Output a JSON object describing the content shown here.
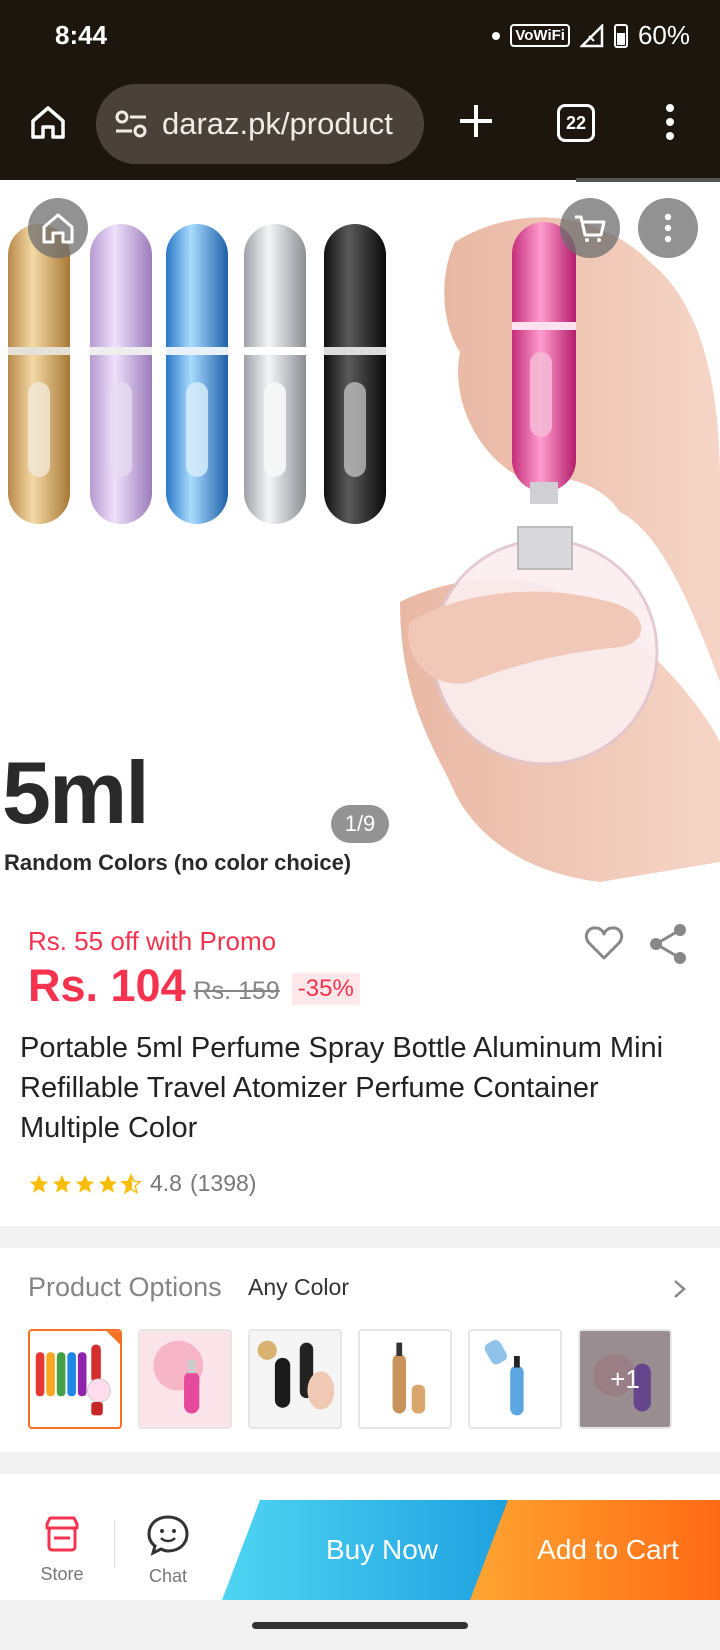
{
  "status_bar": {
    "time": "8:44",
    "network": "VoWiFi",
    "battery": "60%"
  },
  "browser": {
    "url": "daraz.pk/product",
    "tab_count": "22"
  },
  "hero": {
    "counter": "1/9",
    "text_size": "5ml",
    "text_colors": "Random Colors (no color choice)"
  },
  "product": {
    "promo": "Rs. 55 off with Promo",
    "price": "Rs. 104",
    "old_price": "Rs. 159",
    "discount": "-35%",
    "title": "Portable 5ml Perfume Spray Bottle Aluminum Mini Refillable Travel Atomizer Perfume Container Multiple Color",
    "rating": "4.8",
    "rating_count": "(1398)",
    "stars": 4.8
  },
  "options": {
    "label": "Product Options",
    "value": "Any Color",
    "more_count": "+1"
  },
  "bottom_bar": {
    "store": "Store",
    "chat": "Chat",
    "buy_now": "Buy Now",
    "add_to_cart": "Add to Cart"
  },
  "colors": {
    "price_red": "#f5334f",
    "accent_orange": "#f57224",
    "buy_now_blue": "#1ea0e0",
    "cart_orange": "#ff6a14"
  }
}
